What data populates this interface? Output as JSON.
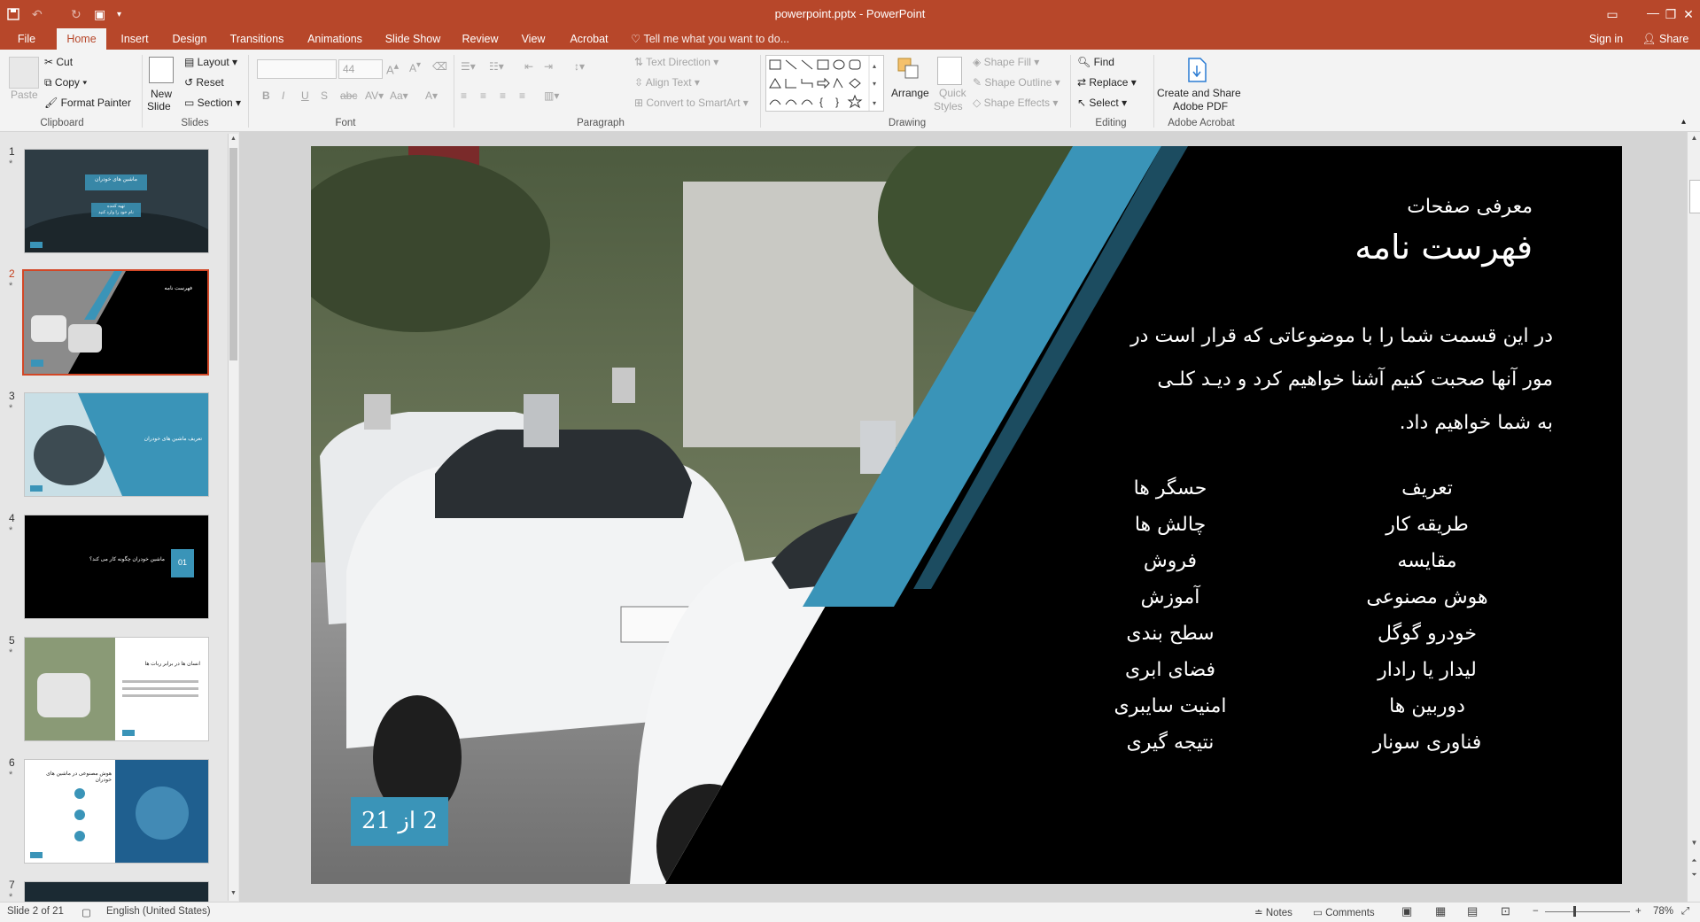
{
  "window": {
    "title": "powerpoint.pptx - PowerPoint",
    "minimize": "—",
    "restore": "❐",
    "close": "✕"
  },
  "tabs": [
    {
      "label": "File"
    },
    {
      "label": "Home"
    },
    {
      "label": "Insert"
    },
    {
      "label": "Design"
    },
    {
      "label": "Transitions"
    },
    {
      "label": "Animations"
    },
    {
      "label": "Slide Show"
    },
    {
      "label": "Review"
    },
    {
      "label": "View"
    },
    {
      "label": "Acrobat"
    }
  ],
  "tell_me": "Tell me what you want to do...",
  "sign_in": "Sign in",
  "share": "Share",
  "ribbon": {
    "clipboard": {
      "paste": "Paste",
      "cut": "Cut",
      "copy": "Copy",
      "format_painter": "Format Painter",
      "group": "Clipboard"
    },
    "slides": {
      "new_slide": "New",
      "new_slide2": "Slide",
      "layout": "Layout",
      "reset": "Reset",
      "section": "Section",
      "group": "Slides"
    },
    "font": {
      "size": "44",
      "group": "Font"
    },
    "paragraph": {
      "text_direction": "Text Direction",
      "align_text": "Align Text",
      "convert_smartart": "Convert to SmartArt",
      "group": "Paragraph"
    },
    "drawing": {
      "arrange": "Arrange",
      "quick_styles": "Quick",
      "quick_styles2": "Styles",
      "shape_fill": "Shape Fill",
      "shape_outline": "Shape Outline",
      "shape_effects": "Shape Effects",
      "group": "Drawing"
    },
    "editing": {
      "find": "Find",
      "replace": "Replace",
      "select": "Select",
      "group": "Editing"
    },
    "acrobat": {
      "create_share": "Create and Share",
      "adobe_pdf": "Adobe PDF",
      "group": "Adobe Acrobat"
    }
  },
  "thumbnails": [
    {
      "num": "1",
      "star": "*",
      "title": "ماشین های خودران",
      "sub": "تهیه کننده",
      "sub2": "نام خود را وارد کنید"
    },
    {
      "num": "2",
      "star": "*",
      "title": "فهرست نامه"
    },
    {
      "num": "3",
      "star": "*",
      "title": "تعریف ماشین های خودران"
    },
    {
      "num": "4",
      "star": "*",
      "title": "ماشین خودران چگونه کار می کند؟",
      "badge": "01"
    },
    {
      "num": "5",
      "star": "*",
      "title": "انسان ها در برابر ربات ها"
    },
    {
      "num": "6",
      "star": "*",
      "title": "هوش مصنوعی در ماشین های خودران"
    },
    {
      "num": "7",
      "star": "*"
    }
  ],
  "slide": {
    "subtitle": "معرفی صفحات",
    "title": "فهرست نامه",
    "body_lines": [
      "در این قسمت شما را با موضوعاتی که قرار است در",
      "مور آنها صحبت کنیم آشنا خواهیم کرد و دیـد کلـی",
      "به شما خواهیم داد."
    ],
    "col_right": [
      "تعریف",
      "طریقه کار",
      "مقایسه",
      "هوش مصنوعی",
      "خودرو گوگل",
      "لیدار یا رادار",
      "دوربین ها",
      "فناوری سونار"
    ],
    "col_left": [
      "حسگر ها",
      "چالش ها",
      "فروش",
      "آموزش",
      "سطح بندی",
      "فضای ابری",
      "امنیت سایبری",
      "نتیجه گیری"
    ],
    "page_badge": "2 از 21"
  },
  "status": {
    "slide_counter": "Slide 2 of 21",
    "language": "English (United States)",
    "notes": "Notes",
    "comments": "Comments",
    "zoom": "78%"
  },
  "colors": {
    "accent": "#b7472a",
    "slide_blue": "#3a94b8"
  }
}
